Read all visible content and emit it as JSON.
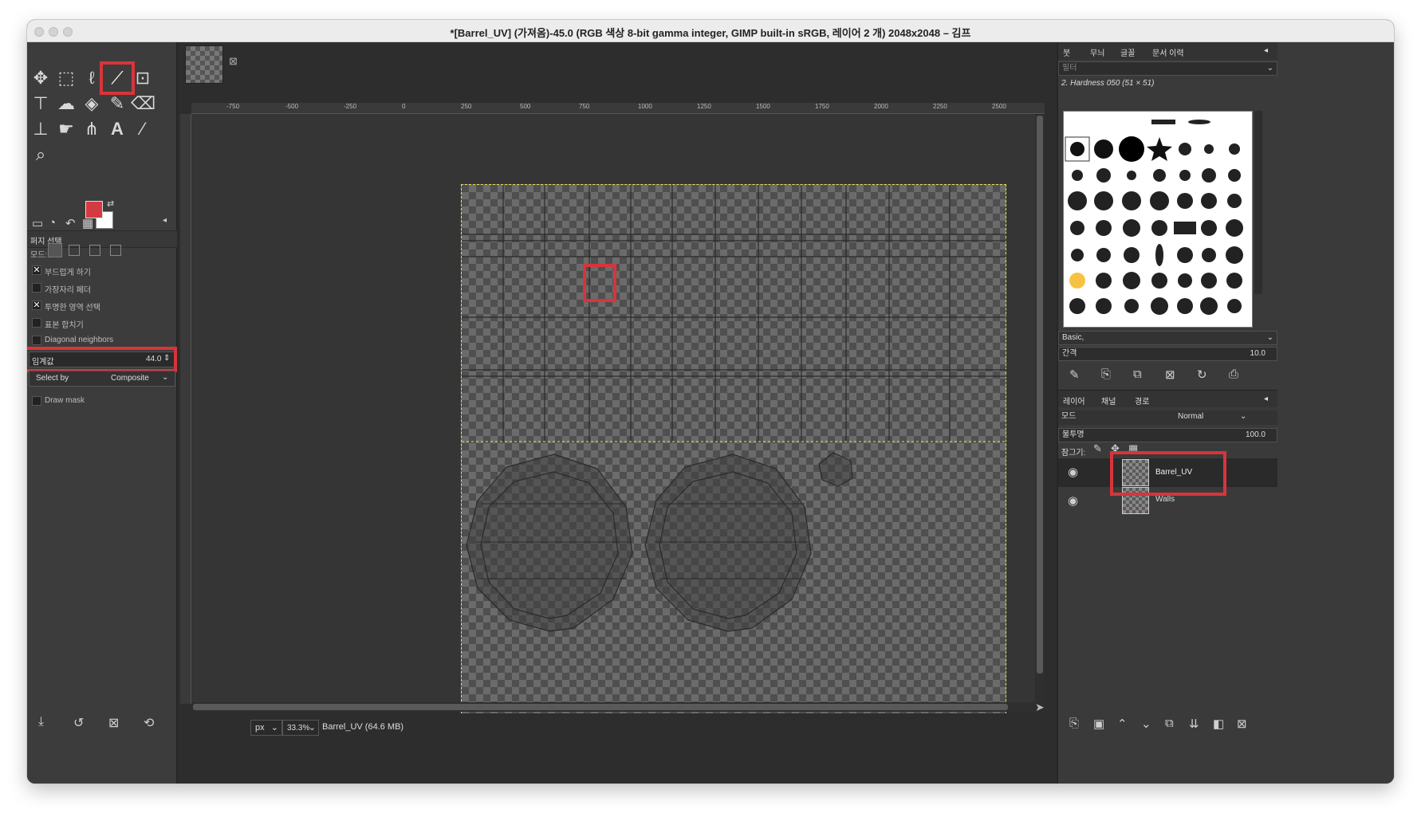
{
  "window": {
    "title": "*[Barrel_UV] (가져옴)-45.0 (RGB 색상 8-bit gamma integer, GIMP built-in sRGB, 레이어 2 개) 2048x2048 – 김프"
  },
  "tool_options": {
    "header": "퍼지 선택",
    "mode_label": "모드:",
    "antialias_label": "부드럽게 하기",
    "feather_label": "가장자리 페더",
    "select_transparent_label": "투명한 영역 선택",
    "sample_merged_label": "표본 합치기",
    "diagonal_label": "Diagonal neighbors",
    "threshold_label": "임계값",
    "threshold_value": "44.0",
    "select_by_label": "Select by",
    "select_by_value": "Composite",
    "draw_mask_label": "Draw mask"
  },
  "rulers": {
    "horizontal": [
      "-750",
      "-500",
      "-250",
      "0",
      "250",
      "500",
      "750",
      "1000",
      "1250",
      "1500",
      "1750",
      "2000",
      "2250",
      "2500"
    ]
  },
  "status": {
    "unit": "px",
    "zoom": "33.3%",
    "image_info": "Barrel_UV (64.6 MB)"
  },
  "brushes": {
    "tabs": [
      "붓",
      "무늬",
      "글꼴",
      "문서 이력"
    ],
    "filter_placeholder": "필터",
    "current_brush": "2. Hardness 050 (51 × 51)",
    "preset": "Basic,",
    "spacing_label": "간격",
    "spacing_value": "10.0"
  },
  "layers": {
    "tabs": [
      "레이어",
      "채널",
      "경로"
    ],
    "mode_label": "모드",
    "mode_value": "Normal",
    "opacity_label": "불투명",
    "opacity_value": "100.0",
    "lock_label": "잠그기:",
    "items": [
      {
        "name": "Barrel_UV"
      },
      {
        "name": "Walls"
      }
    ]
  },
  "colors": {
    "foreground": "#d23b3f",
    "background": "#ffffff",
    "highlight": "#d8343b"
  }
}
